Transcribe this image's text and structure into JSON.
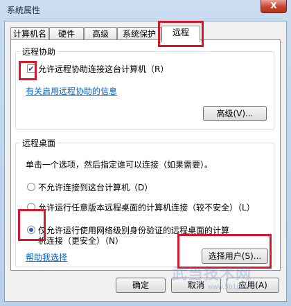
{
  "window": {
    "title": "系统属性",
    "close_label": "X"
  },
  "tabs": [
    "计算机名",
    "硬件",
    "高级",
    "系统保护",
    "远程"
  ],
  "remote_assistance": {
    "group_label": "远程协助",
    "allow_label": "允许远程协助连接这台计算机（R）",
    "allow_checked": true,
    "info_link": "有关启用远程协助的信息",
    "advanced_button": "高级(V)..."
  },
  "remote_desktop": {
    "group_label": "远程桌面",
    "instruction": "单击一个选项，然后指定谁可以连接（如果需要）。",
    "options": [
      {
        "label": "不允许连接到这台计算机（D）",
        "selected": false
      },
      {
        "label": "允许运行任意版本远程桌面的计算机连接（较不安全）（L）",
        "selected": false
      },
      {
        "label_line1": "仅允许运行使用网络级别身份验证的远程桌面的计算",
        "label_line2": "机连接（更安全）（N）",
        "selected": true
      }
    ],
    "help_link": "帮助我选择",
    "select_users_button": "选择用户(S)..."
  },
  "footer": {
    "ok_button": "确定",
    "cancel_button": "取消",
    "apply_button": "应用(A)"
  },
  "watermark": {
    "text": "武当技术网",
    "url": "www.5b1p.com"
  }
}
